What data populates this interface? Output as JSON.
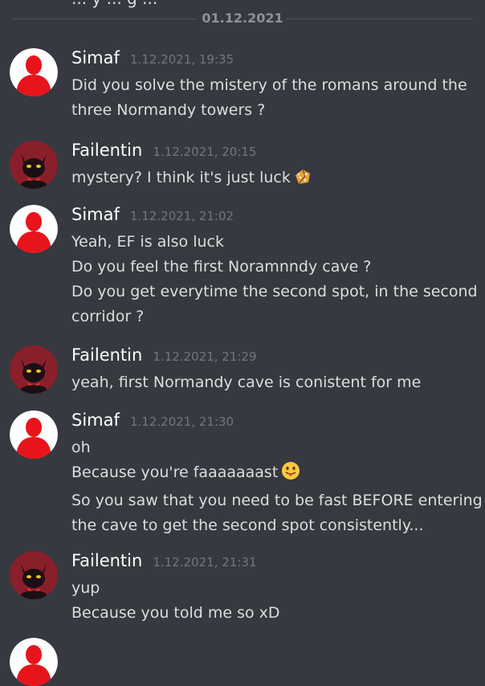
{
  "top_partial_text": "... y ... g ...",
  "date_divider": "01.12.2021",
  "messages": [
    {
      "author": "Simaf",
      "avatar": "red-silhouette-avatar",
      "timestamp": "1.12.2021, 19:35",
      "lines": [
        "Did you solve the mistery of the romans around the",
        "three Normandy towers ?"
      ]
    },
    {
      "author": "Failentin",
      "avatar": "black-cat-avatar",
      "timestamp": "1.12.2021, 20:15",
      "lines": [
        "mystery? I think it's just luck"
      ],
      "emoji": "dice-emoji"
    },
    {
      "author": "Simaf",
      "avatar": "red-silhouette-avatar",
      "timestamp": "1.12.2021, 21:02",
      "lines": [
        "Yeah, EF is also luck",
        "Do you feel the first Noramnndy cave ?",
        "Do you get everytime the second spot, in the second",
        "corridor ?"
      ]
    },
    {
      "author": "Failentin",
      "avatar": "black-cat-avatar",
      "timestamp": "1.12.2021, 21:29",
      "lines": [
        "yeah, first Normandy cave is conistent for me"
      ]
    },
    {
      "author": "Simaf",
      "avatar": "red-silhouette-avatar",
      "timestamp": "1.12.2021, 21:30",
      "lines": [
        "oh",
        "Because you're faaaaaaast",
        "So you saw that you need to be fast BEFORE entering",
        "the cave to get the second spot consistently..."
      ],
      "emoji": "tongue-out-emoji"
    },
    {
      "author": "Failentin",
      "avatar": "black-cat-avatar",
      "timestamp": "1.12.2021, 21:31",
      "lines": [
        "yup",
        "Because you told me so xD"
      ]
    }
  ],
  "colors": {
    "background": "#36393f",
    "username": "#ffffff",
    "message_text": "#dcddde",
    "timestamp": "#72767d",
    "divider_line": "#4f545c",
    "simaf_avatar_red": "#e8141c",
    "failentin_avatar_bg": "#8a1f2c"
  }
}
